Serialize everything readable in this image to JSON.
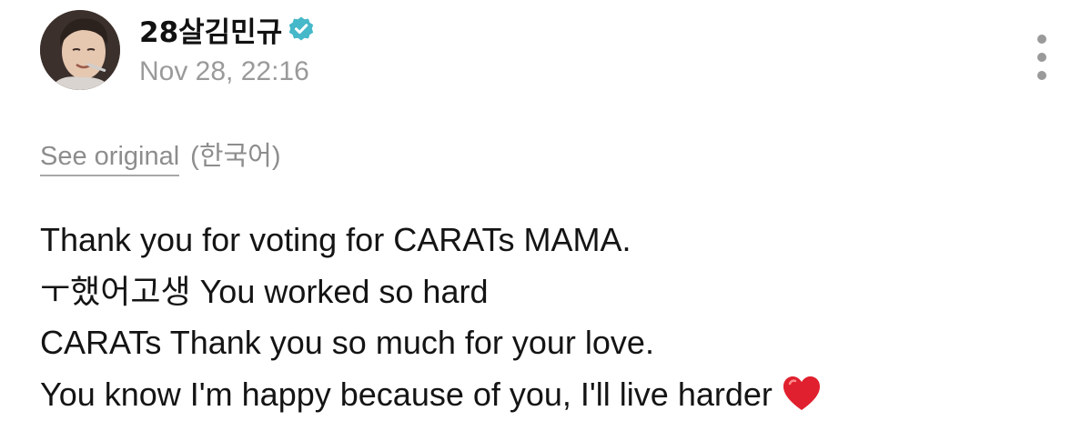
{
  "post": {
    "author": {
      "name": "28살김민규",
      "verified_icon": "verified-check-badge-icon",
      "avatar_icon": "profile-photo"
    },
    "timestamp": "Nov 28, 22:16",
    "more_icon": "vertical-ellipsis-icon",
    "translation": {
      "see_original_label": "See original",
      "language_label": "(한국어)"
    },
    "body_lines": [
      "Thank you for voting for CARATs MAMA.",
      "ㅜ했어고생 You worked so hard",
      "CARATs Thank you so much for your love.",
      "You know I'm happy because of you, I'll live harder"
    ],
    "trailing_emoji_icon": "red-heart-icon"
  },
  "colors": {
    "verified_badge": "#45b8c9",
    "heart": "#e0202e",
    "muted_text": "#8d8d8d",
    "timestamp_text": "#9a9a9a",
    "body_text": "#141414"
  }
}
